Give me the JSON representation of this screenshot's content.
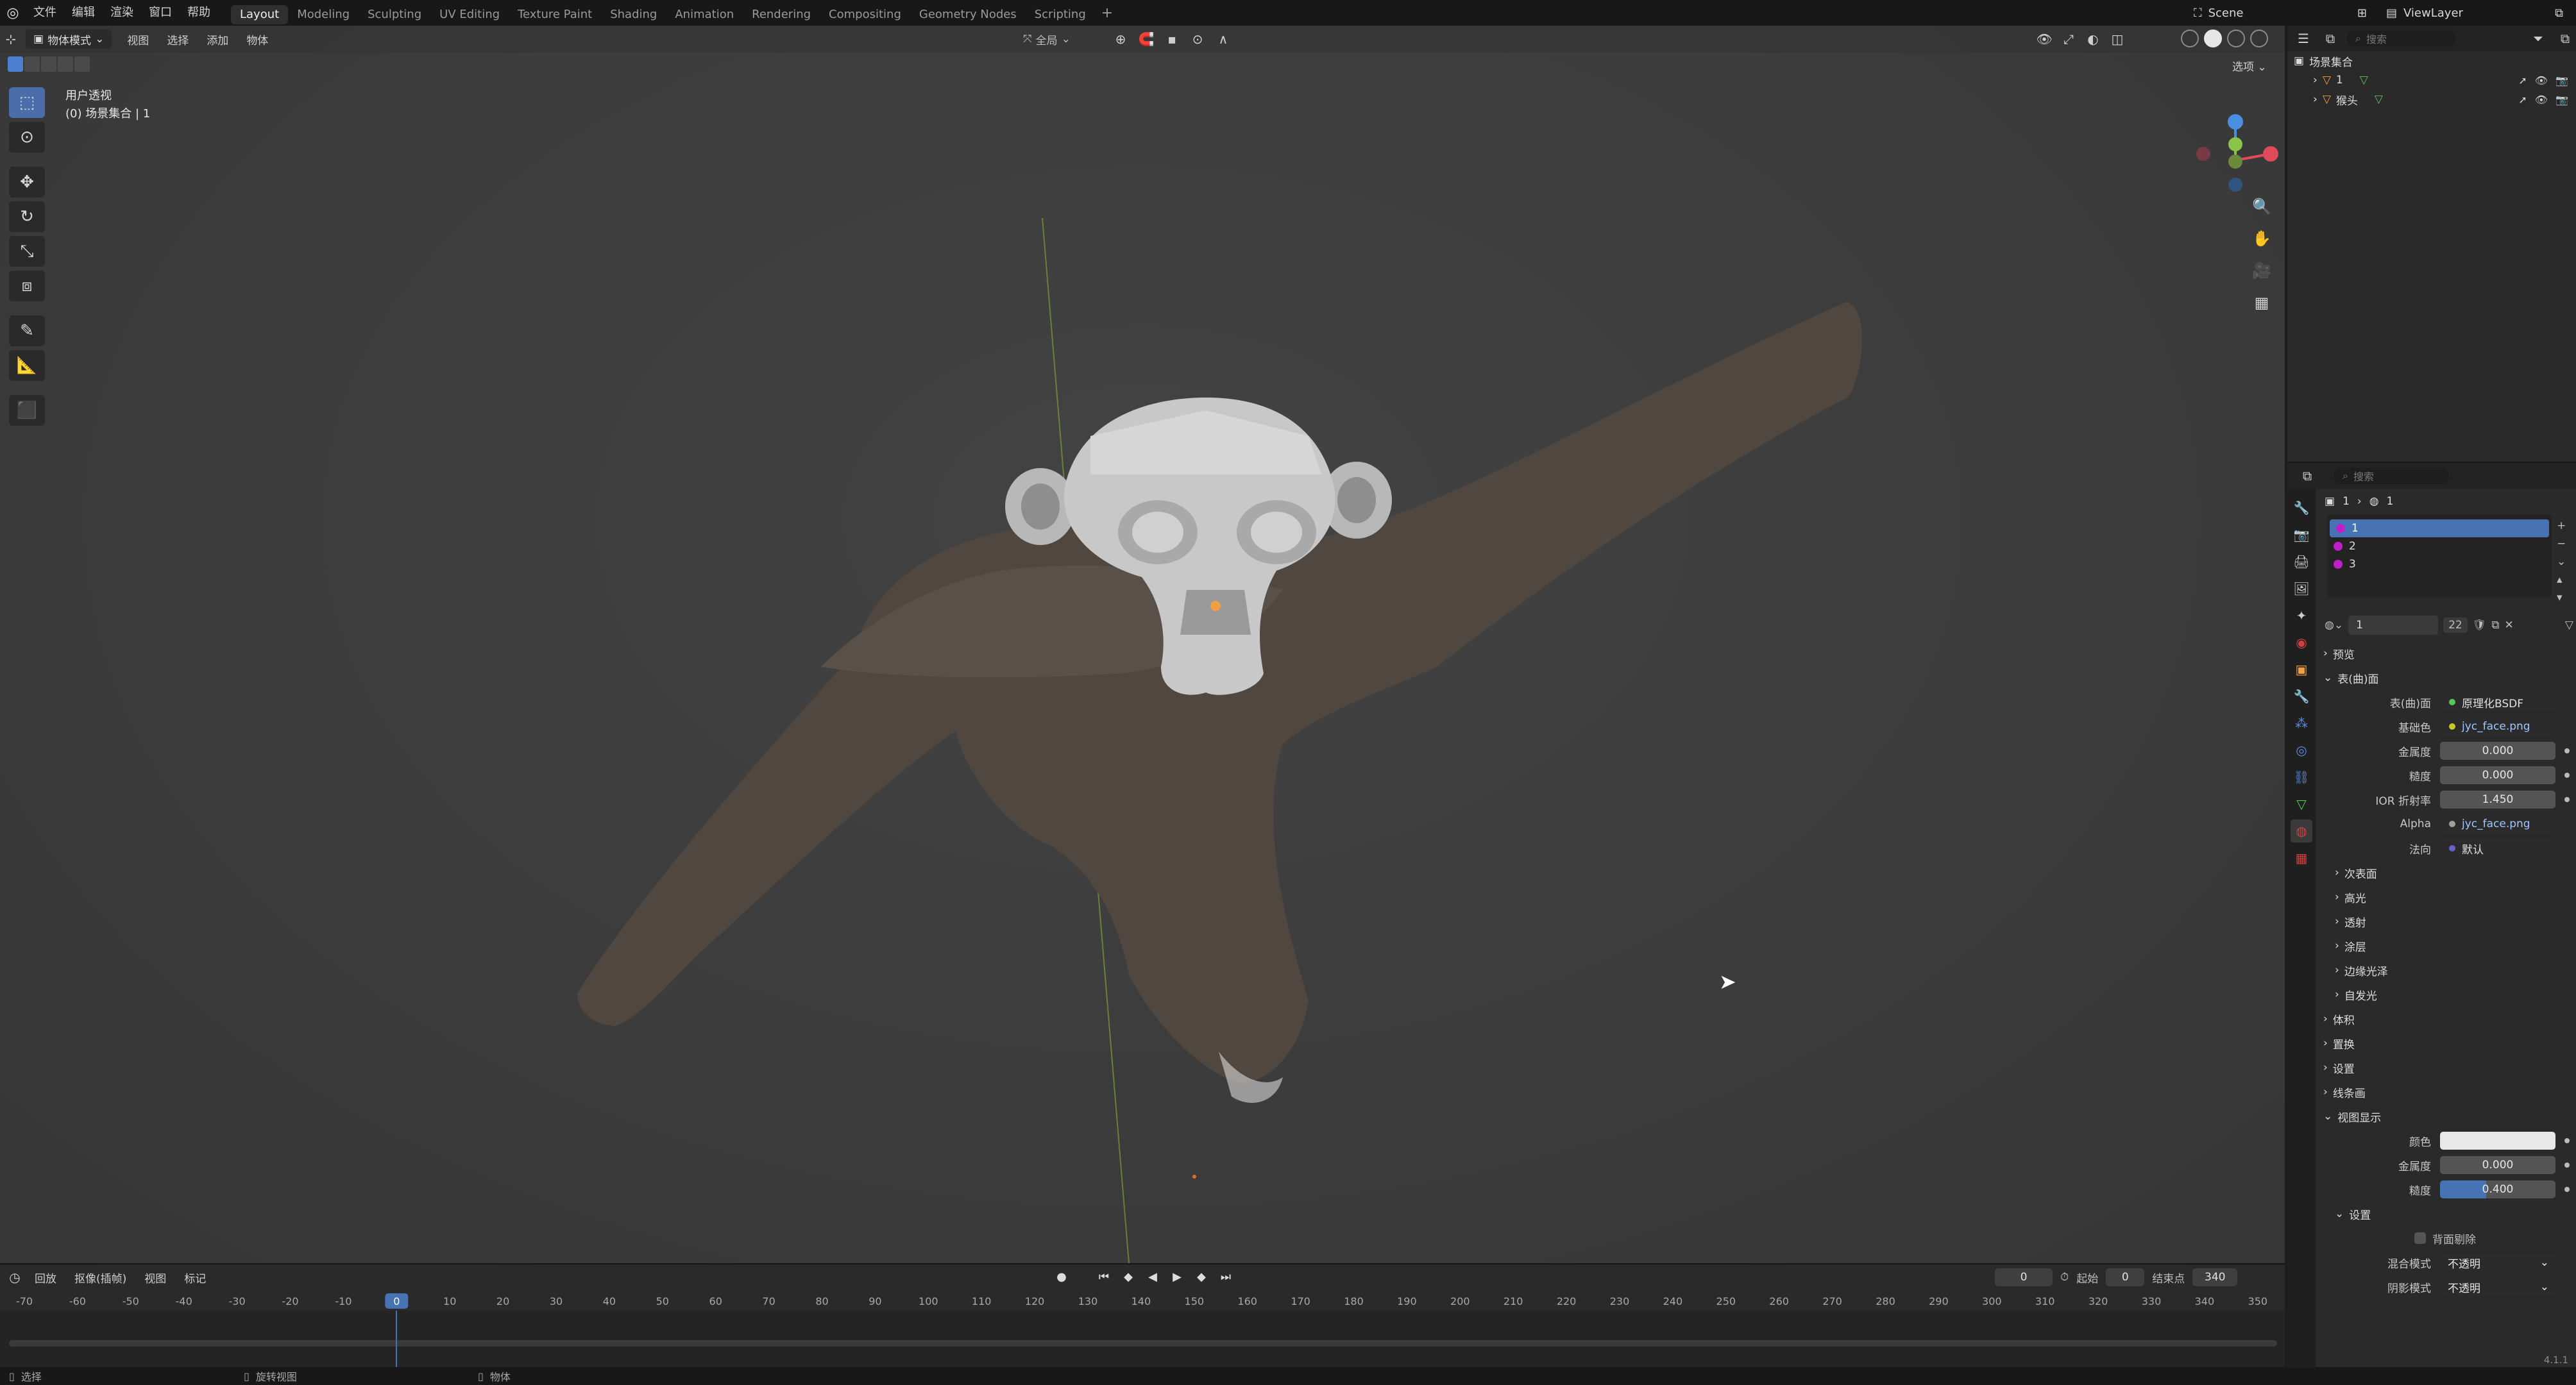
{
  "menu": {
    "items": [
      "文件",
      "编辑",
      "渲染",
      "窗口",
      "帮助"
    ],
    "workspaces": [
      "Layout",
      "Modeling",
      "Sculpting",
      "UV Editing",
      "Texture Paint",
      "Shading",
      "Animation",
      "Rendering",
      "Compositing",
      "Geometry Nodes",
      "Scripting"
    ],
    "active_workspace": "Layout",
    "add": "+",
    "scene": "Scene",
    "view_layer": "ViewLayer"
  },
  "viewport": {
    "mode": "物体模式",
    "menus": [
      "视图",
      "选择",
      "添加",
      "物体"
    ],
    "transform": "全局",
    "info_line1": "用户透视",
    "info_line2": "(0) 场景集合 | 1",
    "options": "选项"
  },
  "timeline": {
    "menus": [
      "回放",
      "抠像(插帧)",
      "视图",
      "标记"
    ],
    "current_frame": "0",
    "start_label": "起始",
    "start": "0",
    "end_label": "结束点",
    "end": "340",
    "ticks": [
      "-70",
      "-60",
      "-50",
      "-40",
      "-30",
      "-20",
      "-10",
      "0",
      "10",
      "20",
      "30",
      "40",
      "50",
      "60",
      "70",
      "80",
      "90",
      "100",
      "110",
      "120",
      "130",
      "140",
      "150",
      "160",
      "170",
      "180",
      "190",
      "200",
      "210",
      "220",
      "230",
      "240",
      "250",
      "260",
      "270",
      "280",
      "290",
      "300",
      "310",
      "320",
      "330",
      "340",
      "350"
    ]
  },
  "status": {
    "select": "选择",
    "rotate": "旋转视图",
    "object": "物体",
    "version": "4.1.1"
  },
  "outliner": {
    "search_placeholder": "搜索",
    "collection": "场景集合",
    "rows": [
      {
        "name": "1"
      },
      {
        "name": "猴头"
      }
    ]
  },
  "properties": {
    "search_placeholder": "搜索",
    "crumb_object": "1",
    "crumb_material": "1",
    "slots": [
      "1",
      "2",
      "3"
    ],
    "material_name": "1",
    "material_users": "22",
    "panels": {
      "preview": "预览",
      "surface": "表(曲)面",
      "volume": "体积",
      "displacement": "置换",
      "settings": "设置",
      "lineart": "线条画",
      "viewport_display": "视图显示"
    },
    "surface": {
      "shader_label": "表(曲)面",
      "shader_value": "原理化BSDF",
      "base_color_label": "基础色",
      "base_color_value": "jyc_face.png",
      "metallic_label": "金属度",
      "metallic_value": "0.000",
      "roughness_label": "糙度",
      "roughness_value": "0.000",
      "ior_label": "IOR 折射率",
      "ior_value": "1.450",
      "alpha_label": "Alpha",
      "alpha_value": "jyc_face.png",
      "normal_label": "法向",
      "normal_value": "默认",
      "subpanels": [
        "次表面",
        "高光",
        "透射",
        "涂层",
        "边缘光泽",
        "自发光"
      ]
    },
    "display": {
      "color_label": "颜色",
      "metallic_label": "金属度",
      "metallic_value": "0.000",
      "roughness_label": "糙度",
      "roughness_value": "0.400",
      "roughness_fraction": 0.4,
      "settings_label": "设置",
      "backface_label": "背面剔除",
      "blend_label": "混合模式",
      "blend_value": "不透明",
      "shadow_label": "阴影模式",
      "shadow_value": "不透明"
    }
  },
  "colors": {
    "accent": "#4772b3",
    "slot_icon": "#c01fc8",
    "axis_x": "#e04a5a",
    "axis_y": "#8bc34a",
    "axis_z": "#4a8ee0"
  }
}
